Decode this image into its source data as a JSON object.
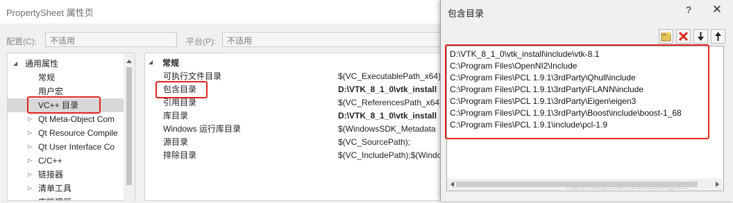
{
  "property_sheet": {
    "title": "PropertySheet 属性页",
    "config_label": "配置(C):",
    "config_value": "不适用",
    "platform_label": "平台(P):",
    "platform_value": "不适用",
    "tree": [
      "通用属性",
      "常规",
      "用户宏",
      "VC++ 目录",
      "Qt Meta-Object Com",
      "Qt Resource Compile",
      "Qt User Interface Co",
      "C/C++",
      "链接器",
      "清单工具",
      "库管理器"
    ],
    "grid_section": "常规",
    "grid": [
      {
        "name": "可执行文件目录",
        "value": "$(VC_ExecutablePath_x64)"
      },
      {
        "name": "包含目录",
        "value": "D:\\VTK_8_1_0\\vtk_install"
      },
      {
        "name": "引用目录",
        "value": "$(VC_ReferencesPath_x64)"
      },
      {
        "name": "库目录",
        "value": "D:\\VTK_8_1_0\\vtk_install"
      },
      {
        "name": "Windows 运行库目录",
        "value": "$(WindowsSDK_Metadata"
      },
      {
        "name": "源目录",
        "value": "$(VC_SourcePath);"
      },
      {
        "name": "排除目录",
        "value": "$(VC_IncludePath);$(Windo"
      }
    ]
  },
  "dialog": {
    "title": "包含目录",
    "help": "?",
    "close": "✕",
    "toolbar": {
      "new_folder_icon": "new-folder-icon",
      "delete_icon": "delete-icon",
      "move_down_icon": "arrow-down-icon",
      "move_up_icon": "arrow-up-icon"
    },
    "items": [
      "D:\\VTK_8_1_0\\vtk_install\\include\\vtk-8.1",
      "C:\\Program Files\\OpenNI2\\Include",
      "C:\\Program Files\\PCL 1.9.1\\3rdParty\\Qhull\\include",
      "C:\\Program Files\\PCL 1.9.1\\3rdParty\\FLANN\\include",
      "C:\\Program Files\\PCL 1.9.1\\3rdParty\\Eigen\\eigen3",
      "C:\\Program Files\\PCL 1.9.1\\3rdParty\\Boost\\include\\boost-1_68",
      "C:\\Program Files\\PCL 1.9.1\\include\\pcl-1.9"
    ],
    "watermark": "https://blog.csdn.net/xiaolong363"
  },
  "colors": {
    "highlight": "#e0221c",
    "selection": "#d8d8d8"
  }
}
